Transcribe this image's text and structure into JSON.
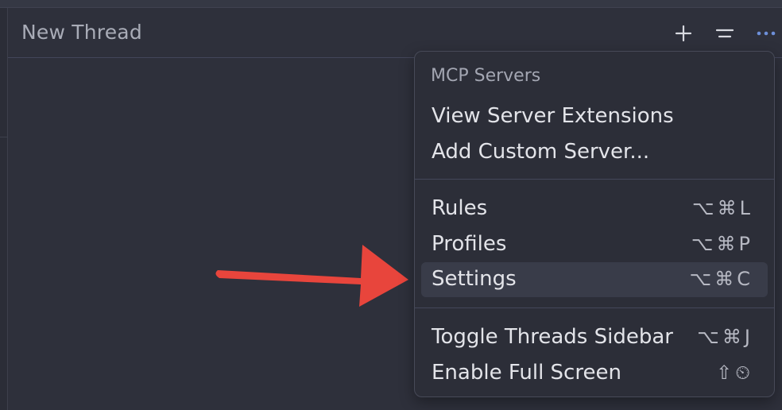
{
  "header": {
    "title": "New Thread",
    "new_button_icon": "plus-icon",
    "collapse_icon": "equals-icon",
    "more_icon": "ellipsis-icon"
  },
  "menu": {
    "section_title": "MCP Servers",
    "mcp_items": [
      {
        "label": "View Server Extensions"
      },
      {
        "label": "Add Custom Server..."
      }
    ],
    "main_items": [
      {
        "label": "Rules",
        "shortcut": "⌥⌘L"
      },
      {
        "label": "Profiles",
        "shortcut": "⌥⌘P"
      },
      {
        "label": "Settings",
        "shortcut": "⌥⌘C",
        "highlighted": true
      }
    ],
    "view_items": [
      {
        "label": "Toggle Threads Sidebar",
        "shortcut": "⌥⌘J"
      },
      {
        "label": "Enable Full Screen",
        "shortcut": "⇧⏲"
      }
    ]
  },
  "annotation": {
    "arrow_color": "#e8453c",
    "arrow_icon": "red-arrow-right-icon"
  },
  "colors": {
    "background": "#2e303b",
    "menu_background": "#2c2e38",
    "highlight": "#393c49",
    "accent": "#6d8fd9"
  }
}
